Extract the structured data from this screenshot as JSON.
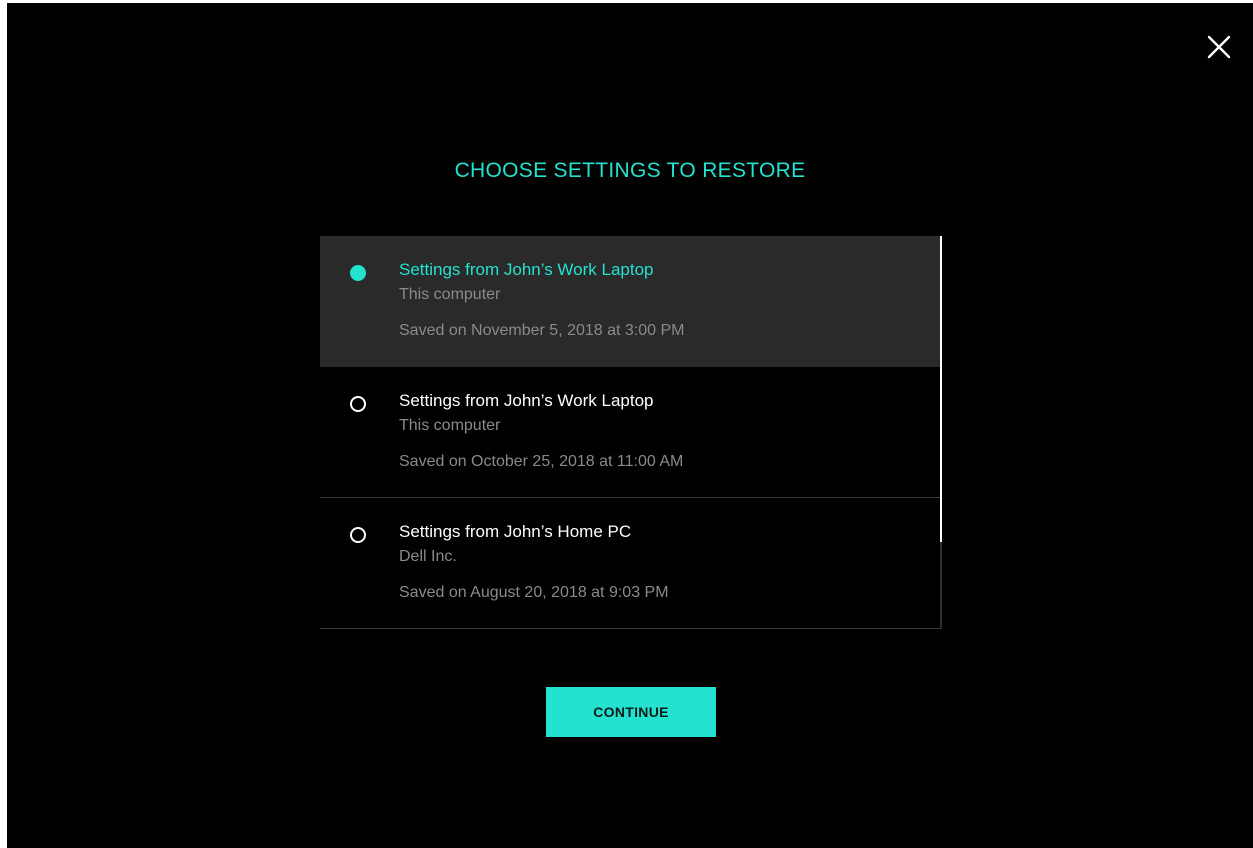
{
  "colors": {
    "accent": "#23e2cf",
    "background": "#000000",
    "selected_row": "#2a2a2a",
    "muted_text": "#8a8a8a",
    "primary_text": "#ffffff"
  },
  "dialog": {
    "title": "CHOOSE SETTINGS TO RESTORE",
    "close_icon": "close-icon",
    "continue_label": "CONTINUE",
    "selected_index": 0,
    "items": [
      {
        "name": "Settings from John’s Work Laptop",
        "device": "This computer",
        "saved": "Saved on November 5, 2018 at 3:00 PM",
        "selected": true
      },
      {
        "name": "Settings from John’s Work Laptop",
        "device": "This computer",
        "saved": "Saved on October 25, 2018 at 11:00 AM",
        "selected": false
      },
      {
        "name": "Settings from John’s Home PC",
        "device": "Dell Inc.",
        "saved": "Saved on August 20, 2018 at 9:03 PM",
        "selected": false
      }
    ]
  }
}
